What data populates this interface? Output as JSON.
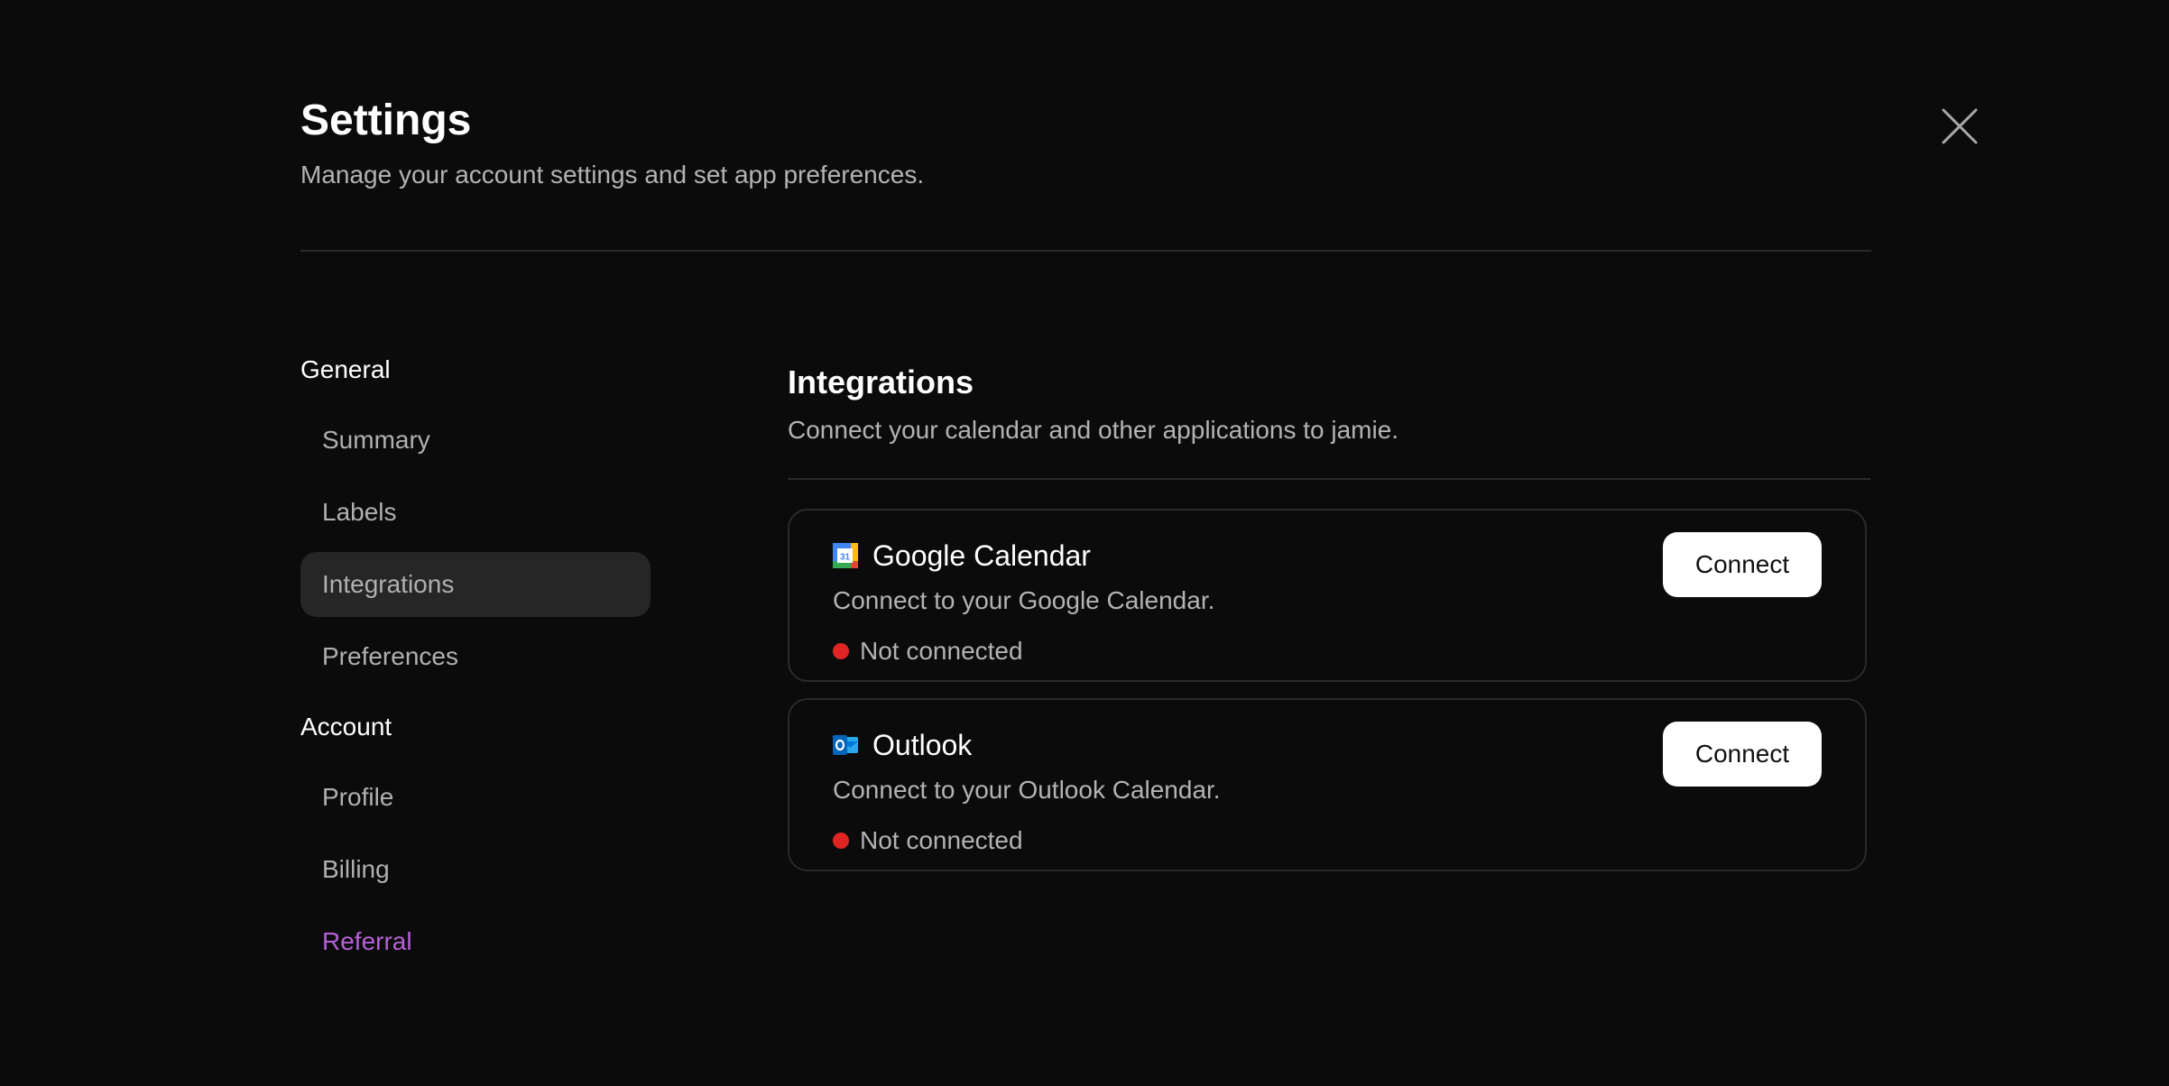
{
  "header": {
    "title": "Settings",
    "subtitle": "Manage your account settings and set app preferences."
  },
  "sidebar": {
    "groups": [
      {
        "label": "General",
        "items": [
          {
            "label": "Summary"
          },
          {
            "label": "Labels"
          },
          {
            "label": "Integrations"
          },
          {
            "label": "Preferences"
          }
        ]
      },
      {
        "label": "Account",
        "items": [
          {
            "label": "Profile"
          },
          {
            "label": "Billing"
          },
          {
            "label": "Referral"
          }
        ]
      }
    ],
    "active_item": "Integrations",
    "referral_color": "#b561d6"
  },
  "main": {
    "title": "Integrations",
    "subtitle": "Connect your calendar and other applications to jamie.",
    "integrations": [
      {
        "name": "Google Calendar",
        "icon": "google-calendar-icon",
        "description": "Connect to your Google Calendar.",
        "status": "Not connected",
        "button_label": "Connect"
      },
      {
        "name": "Outlook",
        "icon": "outlook-icon",
        "description": "Connect to your Outlook Calendar.",
        "status": "Not connected",
        "button_label": "Connect"
      }
    ]
  },
  "colors": {
    "background": "#0b0b0b",
    "status_disconnected": "#e02424",
    "active_item_bg": "#262626"
  }
}
